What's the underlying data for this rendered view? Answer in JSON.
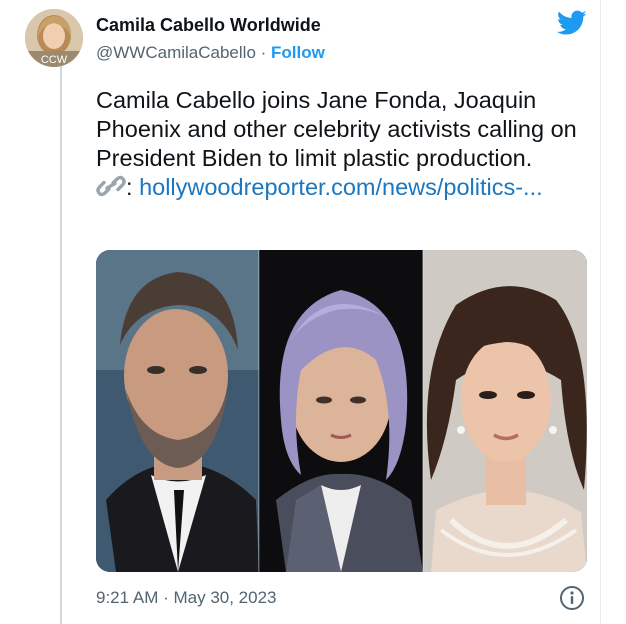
{
  "author": {
    "display_name": "Camila Cabello Worldwide",
    "handle": "@WWCamilaCabello",
    "separator": " · ",
    "follow_label": "Follow",
    "avatar_text": "CCW"
  },
  "tweet": {
    "text": "Camila Cabello joins Jane Fonda, Joaquin Phoenix and other celebrity activists calling on President Biden to limit plastic production.",
    "link_prefix": ":",
    "link_text": "hollywoodreporter.com/news/politics-...",
    "timestamp": "9:21 AM · May 30, 2023"
  },
  "icons": {
    "brand": "twitter-bird-icon",
    "link": "link-icon",
    "info": "info-icon"
  },
  "colors": {
    "brand": "#1d9bf0",
    "link": "#1b77bf",
    "secondary_text": "#536471"
  }
}
